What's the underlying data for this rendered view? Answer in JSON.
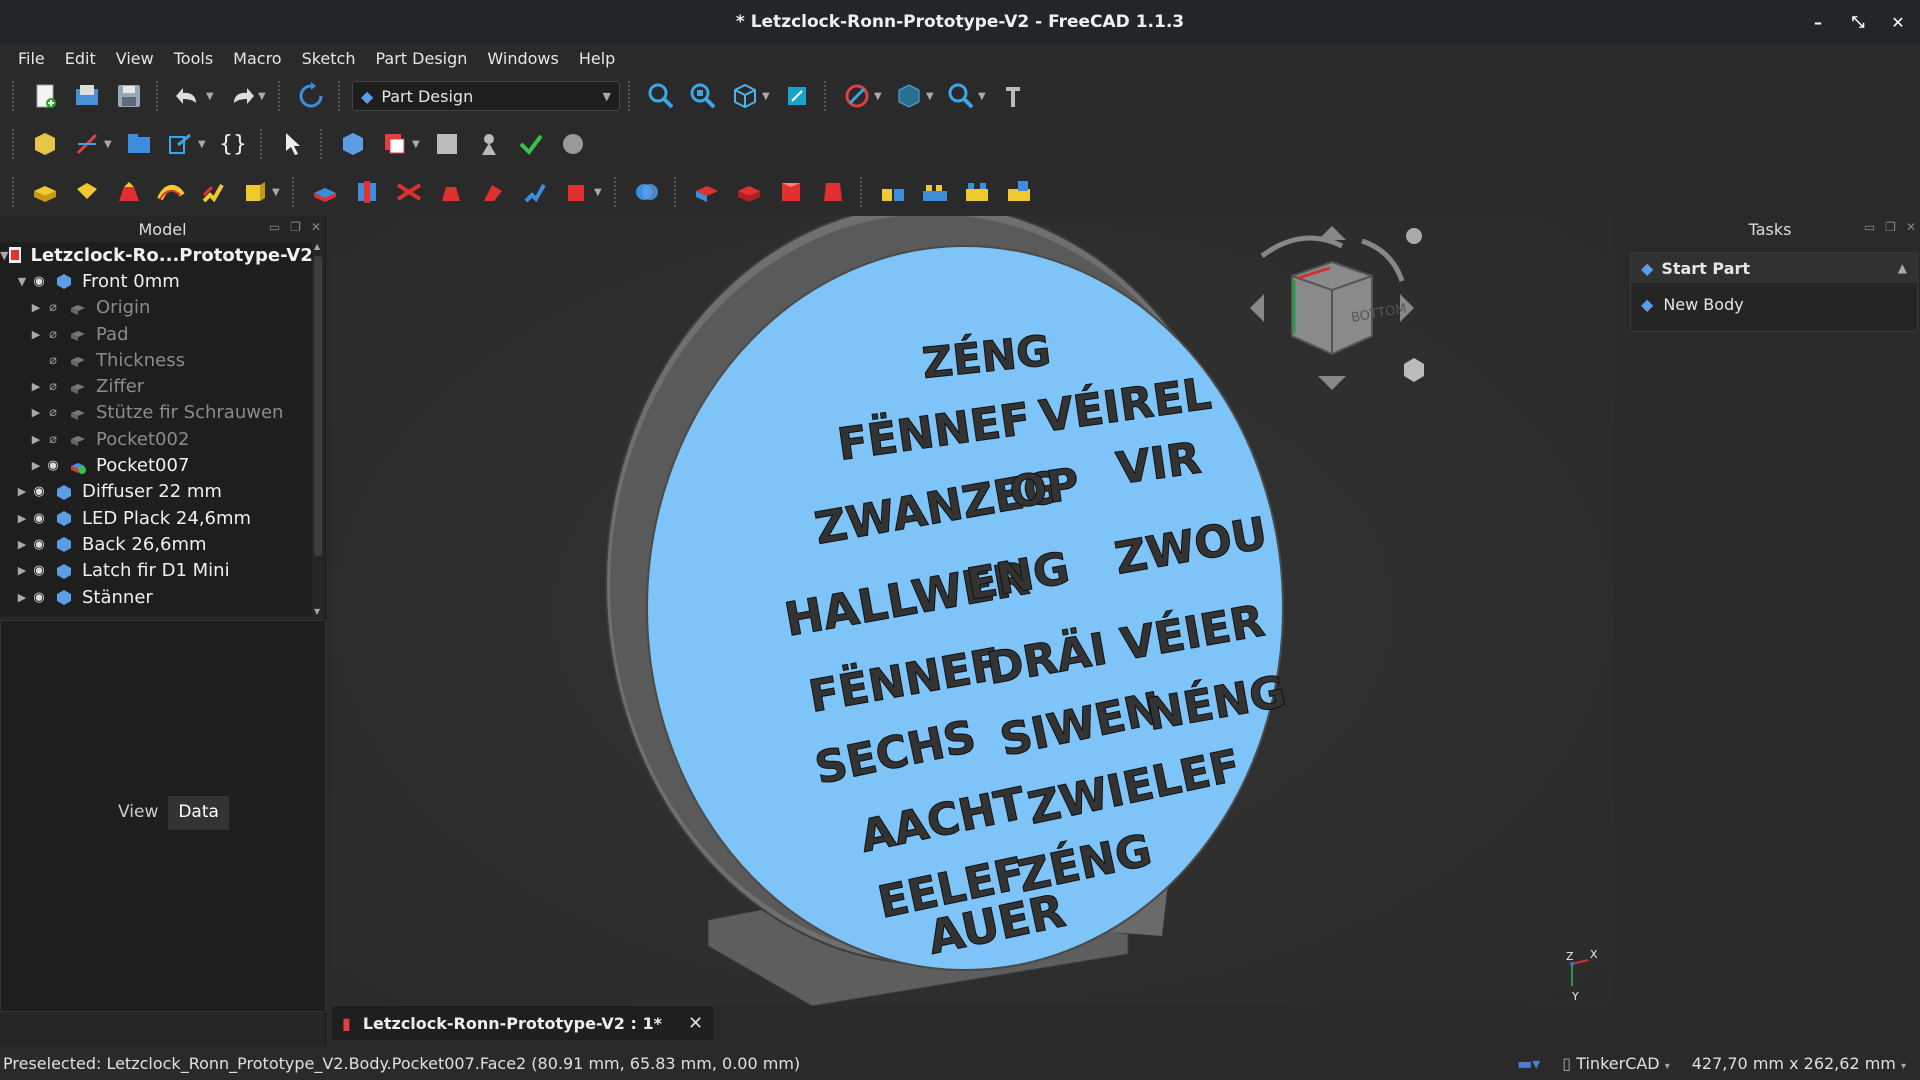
{
  "window": {
    "title": "* Letzclock-Ronn-Prototype-V2 - FreeCAD 1.1.3"
  },
  "menu": [
    "File",
    "Edit",
    "View",
    "Tools",
    "Macro",
    "Sketch",
    "Part Design",
    "Windows",
    "Help"
  ],
  "toolbar": {
    "workbench": "Part Design"
  },
  "model_panel": {
    "title": "Model",
    "tree": [
      {
        "label": "Letzclock-Ro...Prototype-V2",
        "level": 0,
        "expanded": true,
        "root": true,
        "dim": false
      },
      {
        "label": "Front 0mm",
        "level": 1,
        "expanded": true,
        "dim": false
      },
      {
        "label": "Origin",
        "level": 2,
        "dim": true
      },
      {
        "label": "Pad",
        "level": 2,
        "dim": true
      },
      {
        "label": "Thickness",
        "level": 2,
        "dim": true
      },
      {
        "label": "Ziffer",
        "level": 2,
        "dim": true
      },
      {
        "label": "Stütze fir Schrauwen",
        "level": 2,
        "dim": true
      },
      {
        "label": "Pocket002",
        "level": 2,
        "dim": true
      },
      {
        "label": "Pocket007",
        "level": 2,
        "dim": false
      },
      {
        "label": "Diffuser 22 mm",
        "level": 1,
        "dim": false
      },
      {
        "label": "LED Plack 24,6mm",
        "level": 1,
        "dim": false
      },
      {
        "label": "Back 26,6mm",
        "level": 1,
        "dim": false
      },
      {
        "label": "Latch fir D1 Mini",
        "level": 1,
        "dim": false
      },
      {
        "label": "Stänner",
        "level": 1,
        "dim": false
      }
    ],
    "tabs": [
      "View",
      "Data"
    ],
    "active_tab": "Data"
  },
  "viewport": {
    "clock_words": [
      "ZÉNG",
      "FËNNEF",
      "VÉIREL",
      "ZWANZEG",
      "OP",
      "VIR",
      "HALLWER",
      "ENG",
      "ZWOU",
      "FËNNEF",
      "DRÄI",
      "VÉIER",
      "SECHS",
      "SIWEN",
      "NÉNG",
      "AACHT",
      "ZWIELEF",
      "EELEF",
      "ZÉNG",
      "AUER"
    ],
    "navcube_face": "BOTTOM",
    "axis": {
      "z": "Z",
      "x": "X",
      "y": "Y"
    },
    "face_color": "#7ec4f8"
  },
  "document_tab": {
    "label": "Letzclock-Ronn-Prototype-V2 : 1*"
  },
  "tasks": {
    "title": "Tasks",
    "group": "Start Part",
    "items": [
      "New Body"
    ]
  },
  "status": {
    "message": "Preselected: Letzclock_Ronn_Prototype_V2.Body.Pocket007.Face2 (80.91 mm, 65.83 mm, 0.00 mm)",
    "nav_style": "TinkerCAD",
    "dimensions": "427,70 mm x 262,62 mm"
  }
}
